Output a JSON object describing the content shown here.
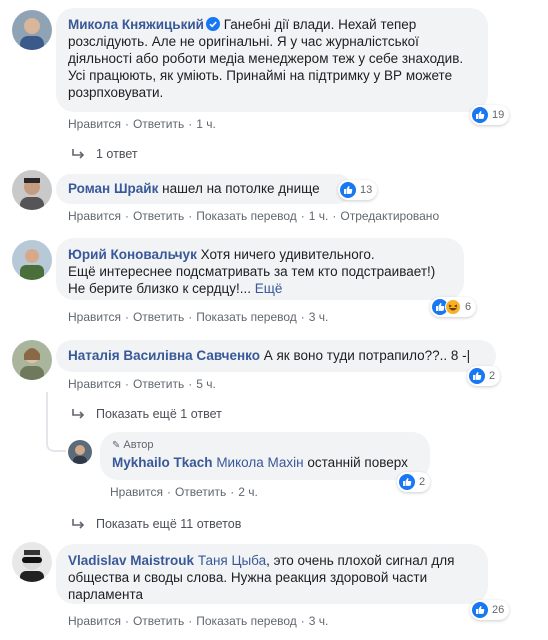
{
  "actions": {
    "like": "Нравится",
    "reply": "Ответить",
    "translate": "Показать перевод",
    "dot": "·",
    "edited": "Отредактировано"
  },
  "comments": [
    {
      "author": "Микола Княжицький",
      "text_lines": [
        "Ганебні дії влади. Нехай тепер",
        "розслідують. Але не оригінальні. Я у час журналістської",
        "діяльності або роботи медіа менеджером теж у себе знаходив.",
        "Усі працюють, як уміють. Принаймі на підтримку у ВР можете",
        "розрпховувати."
      ],
      "time": "1 ч.",
      "reactions": "19",
      "replies_link": "1 ответ"
    },
    {
      "author": "Роман Шрайк",
      "text": "нашел на потолке днище",
      "time": "1 ч.",
      "reactions": "13"
    },
    {
      "author": "Юрий Коновальчук",
      "text_lines": [
        "Хотя ничего удивительного.",
        "Ещё интереснее подсматривать за тем кто подстраивает!)",
        "Не берите близко к сердцу!..."
      ],
      "see_more": "Ещё",
      "time": "3 ч.",
      "reactions": "6"
    },
    {
      "author": "Наталія Василівна Савченко",
      "text": "А як воно туди потрапило??.. 8 -|",
      "time": "5 ч.",
      "reactions": "2",
      "replies_link": "Показать ещё 1 ответ"
    },
    {
      "badge": "Автор",
      "author": "Mykhailo Tkach",
      "tag": "Микола Махін",
      "text": "останній поверх",
      "time": "2 ч.",
      "reactions": "2",
      "replies_link": "Показать ещё 11 ответов"
    },
    {
      "author": "Vladislav Maistrouk",
      "tag": "Таня Цыба",
      "text_lines": [
        ", это очень плохой сигнал для",
        "общества и своды слова. Нужна реакция здоровой части",
        "парламента"
      ],
      "time": "3 ч.",
      "reactions": "26"
    }
  ]
}
